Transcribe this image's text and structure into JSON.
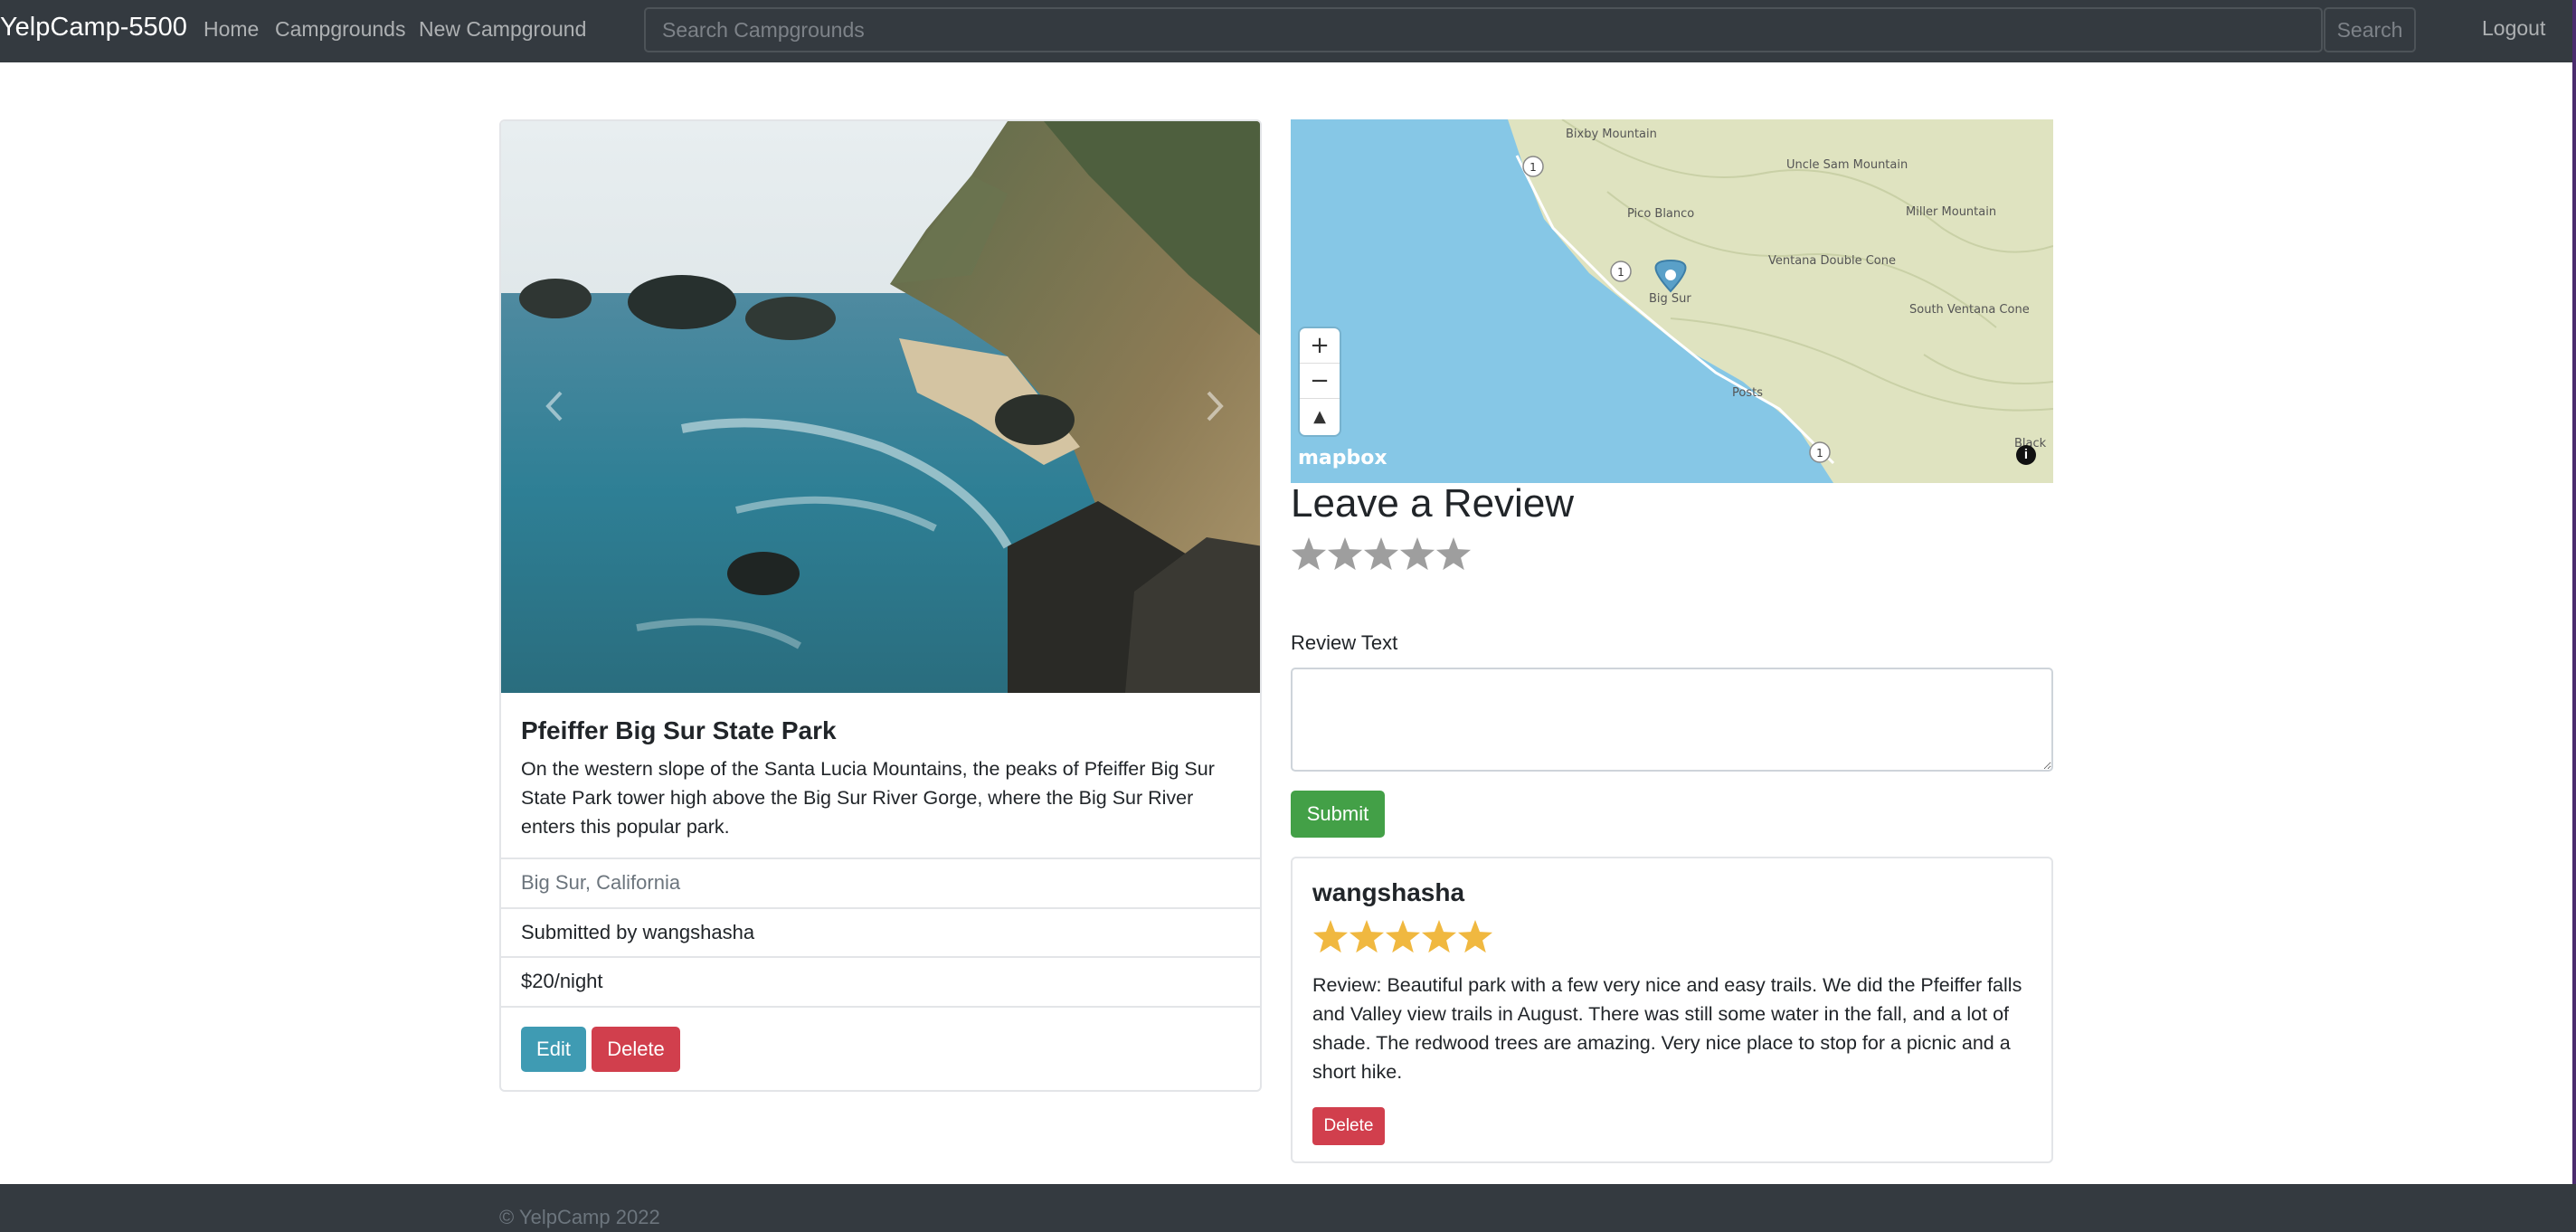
{
  "navbar": {
    "brand": "YelpCamp-5500",
    "links": [
      "Home",
      "Campgrounds",
      "New Campground"
    ],
    "search_placeholder": "Search Campgrounds",
    "search_button": "Search",
    "logout": "Logout"
  },
  "campground": {
    "title": "Pfeiffer Big Sur State Park",
    "description": "On the western slope of the Santa Lucia Mountains, the peaks of Pfeiffer Big Sur State Park tower high above the Big Sur River Gorge, where the Big Sur River enters this popular park.",
    "location": "Big Sur, California",
    "submitted_by": "Submitted by wangshasha",
    "price": "$20/night",
    "edit_label": "Edit",
    "delete_label": "Delete"
  },
  "map": {
    "labels": [
      "Bixby Mountain",
      "Uncle Sam Mountain",
      "Pico Blanco",
      "Miller Mountain",
      "Ventana Double Cone",
      "Big Sur",
      "South Ventana Cone",
      "Posts",
      "Black"
    ],
    "route_badge": "1",
    "zoom_in": "+",
    "zoom_out": "−",
    "attribution": "mapbox",
    "info": "i",
    "marker_color": "#5aa0c8"
  },
  "review_form": {
    "heading": "Leave a Review",
    "rating_value": 0,
    "rating_max": 5,
    "text_label": "Review Text",
    "text_value": "",
    "submit_label": "Submit"
  },
  "reviews": [
    {
      "author": "wangshasha",
      "rating": 5,
      "text": "Review: Beautiful park with a few very nice and easy trails. We did the Pfeiffer falls and Valley view trails in August. There was still some water in the fall, and a lot of shade. The redwood trees are amazing. Very nice place to stop for a picnic and a short hike.",
      "delete_label": "Delete"
    }
  ],
  "footer": {
    "text": "© YelpCamp 2022"
  },
  "colors": {
    "navbar": "#343a40",
    "star_filled": "#f0b840",
    "star_empty": "#9e9e9e",
    "edit": "#3f9bb3",
    "danger": "#d13f4d",
    "success": "#43a047"
  }
}
